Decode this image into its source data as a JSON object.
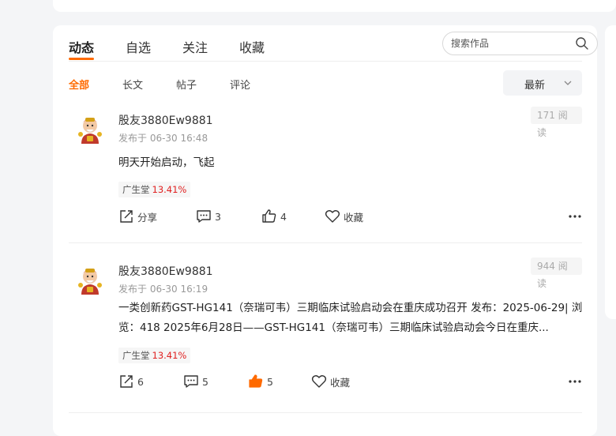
{
  "tabs": [
    {
      "label": "动态",
      "active": true
    },
    {
      "label": "自选",
      "active": false
    },
    {
      "label": "关注",
      "active": false
    },
    {
      "label": "收藏",
      "active": false
    }
  ],
  "search": {
    "placeholder": "搜索作品",
    "icon": "search-icon"
  },
  "filters": [
    {
      "label": "全部",
      "active": true
    },
    {
      "label": "长文",
      "active": false
    },
    {
      "label": "帖子",
      "active": false
    },
    {
      "label": "评论",
      "active": false
    }
  ],
  "sort": {
    "selected": "最新"
  },
  "colors": {
    "accent": "#ff6a00",
    "rise": "#e02020"
  },
  "posts": [
    {
      "username": "股友3880Ew9881",
      "time": "发布于 06-30 16:48",
      "views": "171 阅读",
      "content": "明天开始启动，飞起",
      "stock_name": "广生堂",
      "stock_change": "13.41%",
      "share_label": "分享",
      "comments": "3",
      "likes": "4",
      "liked": false,
      "favorite_label": "收藏"
    },
    {
      "username": "股友3880Ew9881",
      "time": "发布于 06-30 16:19",
      "views": "944 阅读",
      "content": "一类创新药GST-HG141（奈瑞可韦）三期临床试验启动会在重庆成功召开 发布：2025-06-29| 浏览：418 2025年6月28日——GST-HG141（奈瑞可韦）三期临床试验启动会今日在重庆...",
      "stock_name": "广生堂",
      "stock_change": "13.41%",
      "share_label": "6",
      "comments": "5",
      "likes": "5",
      "liked": true,
      "favorite_label": "收藏"
    }
  ]
}
